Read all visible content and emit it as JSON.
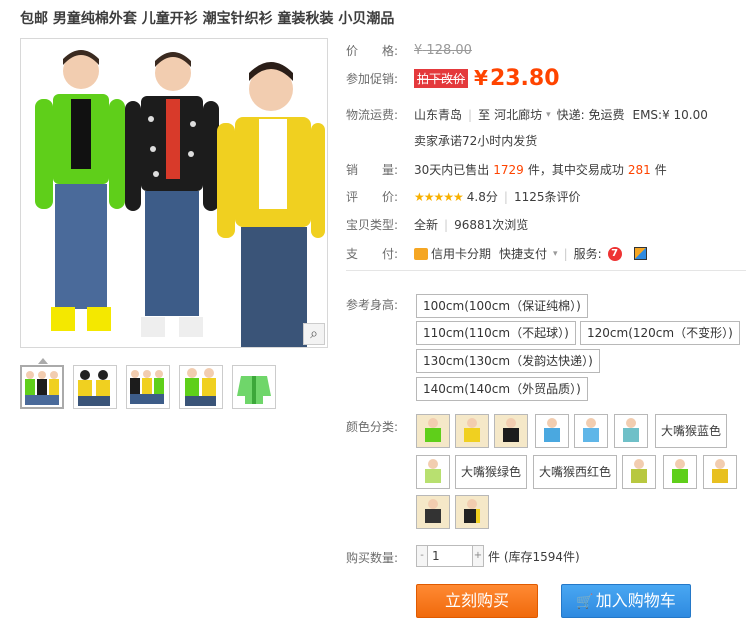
{
  "title": "包邮 男童纯棉外套 儿童开衫 潮宝针织衫 童装秋装 小贝潮品",
  "price": {
    "label": "价　　格:",
    "yen": "¥",
    "value": "128.00"
  },
  "promo": {
    "label": "参加促销:",
    "tag": "拍下改价",
    "yen": "¥",
    "value": "23.80"
  },
  "shipping": {
    "label": "物流运费:",
    "from": "山东青岛",
    "to_prefix": "至",
    "to": "河北廊坊",
    "express": "快递: 免运费",
    "ems": "EMS:¥ 10.00",
    "promise": "卖家承诺72小时内发货"
  },
  "sales": {
    "label": "销　　量:",
    "prefix": "30天内已售出",
    "count": "1729",
    "mid": "件，其中交易成功",
    "success": "281",
    "suffix": "件"
  },
  "rating": {
    "label": "评　　价:",
    "stars": "★★★★★",
    "score": "4.8分",
    "reviews": "1125条评价"
  },
  "item_type": {
    "label": "宝贝类型:",
    "type": "全新",
    "views": "96881次浏览"
  },
  "payment": {
    "label": "支　　付:",
    "credit": "信用卡分期",
    "quick": "快捷支付",
    "service_label": "服务:"
  },
  "height": {
    "label": "参考身高:",
    "options": [
      "100cm(100cm（保证纯棉）)",
      "110cm(110cm（不起球）)",
      "120cm(120cm（不变形）)",
      "130cm(130cm（发韵达快递）)",
      "140cm(140cm（外贸品质）)"
    ]
  },
  "color": {
    "label": "颜色分类:",
    "text_options": [
      "大嘴猴蓝色",
      "大嘴猴绿色",
      "大嘴猴西红色"
    ]
  },
  "quantity": {
    "label": "购买数量:",
    "value": "1",
    "minus": "-",
    "plus": "+",
    "stock": "件 (库存1594件)"
  },
  "buttons": {
    "buy_now": "立刻购买",
    "add_cart": "加入购物车"
  },
  "colors": {
    "accent": "#ff4400",
    "buy": "#f06a0c",
    "cart": "#2e8ae0"
  }
}
